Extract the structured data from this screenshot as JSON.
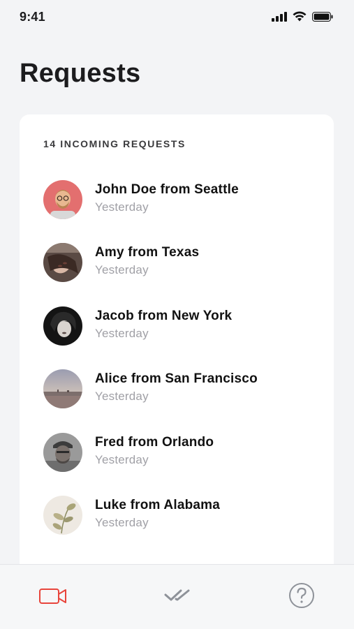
{
  "status_bar": {
    "time": "9:41",
    "icons": [
      "cellular-signal-icon",
      "wifi-icon",
      "battery-icon"
    ]
  },
  "page": {
    "title": "Requests"
  },
  "requests_card": {
    "header": "14 INCOMING REQUESTS",
    "items": [
      {
        "name": "John Doe from Seattle",
        "time": "Yesterday"
      },
      {
        "name": "Amy from Texas",
        "time": "Yesterday"
      },
      {
        "name": "Jacob from New York",
        "time": "Yesterday"
      },
      {
        "name": "Alice from San Francisco",
        "time": "Yesterday"
      },
      {
        "name": "Fred from Orlando",
        "time": "Yesterday"
      },
      {
        "name": "Luke from Alabama",
        "time": "Yesterday"
      }
    ]
  },
  "tab_bar": {
    "tabs": [
      {
        "icon": "video-camera-icon",
        "active": true
      },
      {
        "icon": "double-check-icon",
        "active": false
      },
      {
        "icon": "help-icon",
        "active": false
      }
    ]
  },
  "colors": {
    "accent": "#e8453c",
    "inactive_icon": "#8e9299",
    "background": "#f3f4f6",
    "card": "#ffffff",
    "secondary_text": "#a0a0a6"
  }
}
